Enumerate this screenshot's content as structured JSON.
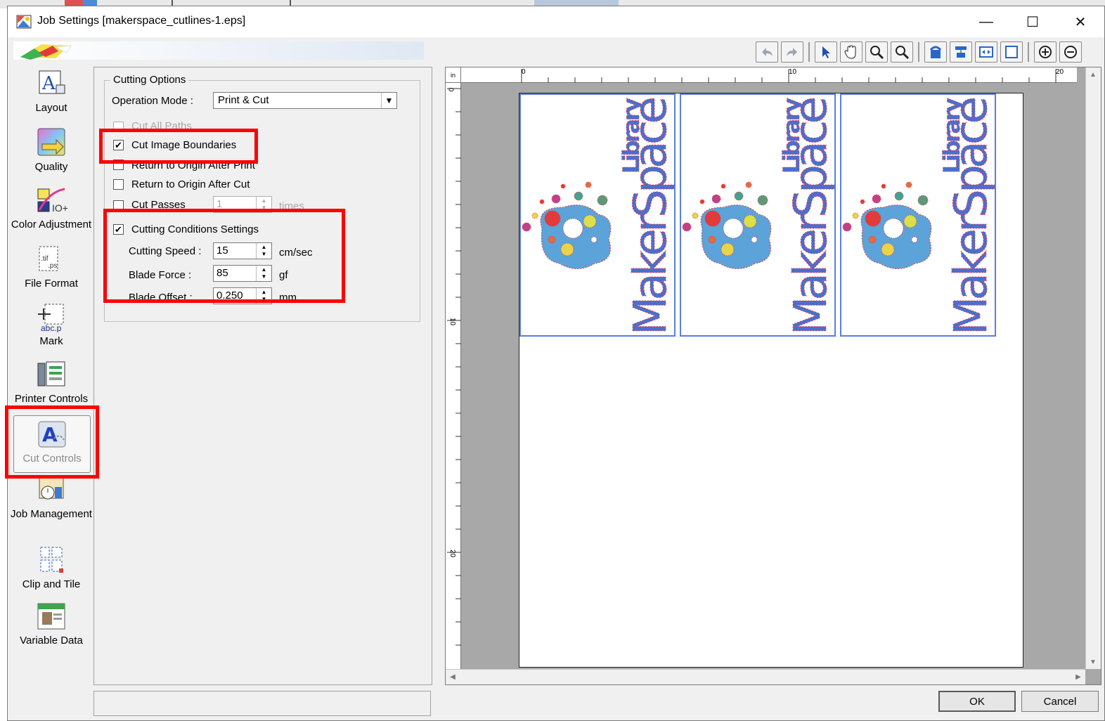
{
  "window": {
    "title": "Job Settings [makerspace_cutlines-1.eps]",
    "minimize_glyph": "—",
    "maximize_glyph": "☐",
    "close_glyph": "✕"
  },
  "toolbar": {
    "icons": [
      "undo-icon",
      "redo-icon",
      "select-arrow-icon",
      "hand-pan-icon",
      "zoom-in-icon",
      "zoom-out-icon",
      "rotate-icon",
      "center-icon",
      "fit-width-icon",
      "fit-page-icon",
      "plus-zoom-icon",
      "minus-zoom-icon"
    ]
  },
  "sidebar": {
    "items": [
      {
        "label": "Layout",
        "icon": "layout-icon"
      },
      {
        "label": "Quality",
        "icon": "quality-icon"
      },
      {
        "label": "Color Adjustment",
        "icon": "color-adjustment-icon"
      },
      {
        "label": "File Format",
        "icon": "file-format-icon"
      },
      {
        "label": "Mark",
        "icon": "mark-icon"
      },
      {
        "label": "Printer Controls",
        "icon": "printer-controls-icon"
      },
      {
        "label": "Cut Controls",
        "icon": "cut-controls-icon"
      },
      {
        "label": "Job Management",
        "icon": "job-management-icon"
      },
      {
        "label": "Clip and Tile",
        "icon": "clip-and-tile-icon"
      },
      {
        "label": "Variable Data",
        "icon": "variable-data-icon"
      }
    ]
  },
  "cutting_options": {
    "group_label": "Cutting Options",
    "operation_mode_label": "Operation Mode :",
    "operation_mode_value": "Print & Cut",
    "cut_all_paths_label": "Cut All Paths",
    "cut_image_boundaries_label": "Cut Image Boundaries",
    "return_origin_print_label": "Return to Origin After Print",
    "return_origin_cut_label": "Return to Origin After Cut",
    "cut_passes_label": "Cut Passes",
    "cut_passes_value": "1",
    "cut_passes_unit": "times",
    "cutting_conditions_label": "Cutting Conditions Settings",
    "cutting_speed_label": "Cutting Speed :",
    "cutting_speed_value": "15",
    "cutting_speed_unit": "cm/sec",
    "blade_force_label": "Blade Force :",
    "blade_force_value": "85",
    "blade_force_unit": "gf",
    "blade_offset_label": "Blade Offset :",
    "blade_offset_value": "0.250",
    "blade_offset_unit": "mm",
    "cut_image_boundaries_checked": true,
    "cutting_conditions_checked": true
  },
  "preview": {
    "ruler_unit": "in",
    "h_ticks": [
      "0",
      "10",
      "20"
    ],
    "v_ticks": [
      "0",
      "10",
      "20"
    ],
    "tile_text_top": "Library",
    "tile_text_main": "MakerSpace",
    "tile_count": 3
  },
  "buttons": {
    "ok": "OK",
    "cancel": "Cancel"
  },
  "colors": {
    "highlight_box": "#ff0000",
    "tile_border": "#5a7fe0",
    "logo_text": "#4a6fd0",
    "logo_blob": "#5ba3d9"
  }
}
